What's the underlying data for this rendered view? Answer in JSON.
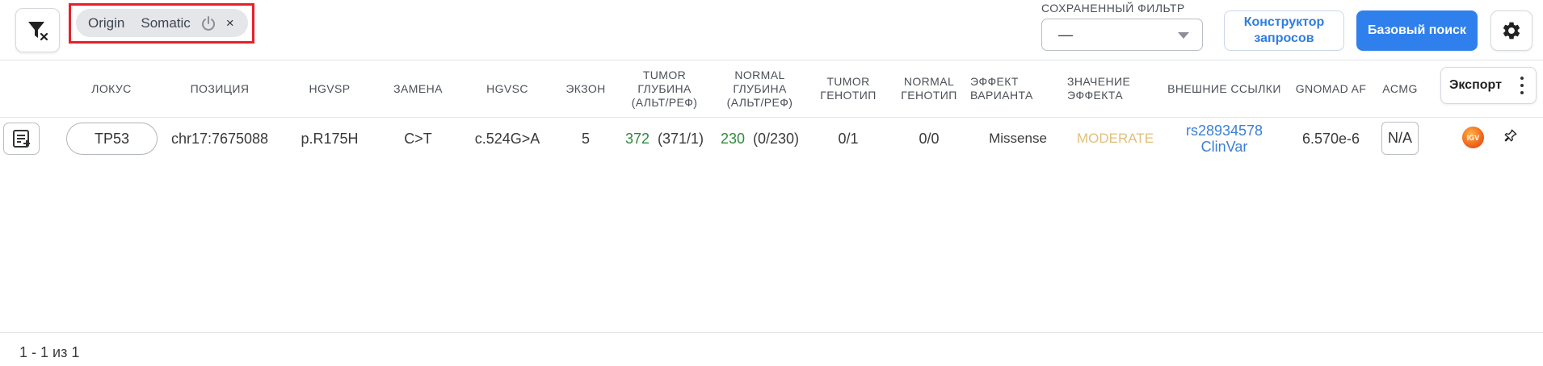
{
  "active_filter": {
    "label": "Origin",
    "value": "Somatic",
    "power_icon": "power-icon",
    "close_symbol": "×"
  },
  "saved_filter": {
    "label": "СОХРАНЕННЫЙ ФИЛЬТР",
    "value": "—"
  },
  "buttons": {
    "query_builder": [
      "Конструктор",
      "запросов"
    ],
    "basic_search": "Базовый поиск",
    "export": "Экспорт",
    "settings_icon": "gear-icon",
    "clear_filter_icon": "filter-clear-icon"
  },
  "colors": {
    "primary": "#2f80ed",
    "link": "#3a7fd6",
    "depth_green": "#2f8a3e",
    "moderate": "#e0c07a",
    "highlight": "#e8202a"
  },
  "table": {
    "columns": {
      "locus": "ЛОКУС",
      "position": "ПОЗИЦИЯ",
      "hgvsp": "HGVSP",
      "substitution": "ЗАМЕНА",
      "hgvsc": "HGVSC",
      "exon": "ЭКЗОН",
      "tumor_depth": [
        "TUMOR",
        "ГЛУБИНА",
        "(АЛЬТ/РЕФ)"
      ],
      "normal_depth": [
        "NORMAL",
        "ГЛУБИНА",
        "(АЛЬТ/РЕФ)"
      ],
      "tumor_genotype": [
        "TUMOR",
        "ГЕНОТИП"
      ],
      "normal_genotype": [
        "NORMAL",
        "ГЕНОТИП"
      ],
      "variant_effect": [
        "ЭФФЕКТ",
        "ВАРИАНТА"
      ],
      "effect_impact": [
        "ЗНАЧЕНИЕ",
        "ЭФФЕКТА"
      ],
      "external_links": "ВНЕШНИЕ ССЫЛКИ",
      "gnomad_af": "GNOMAD AF",
      "acmg": "ACMG"
    },
    "rows": [
      {
        "locus": "TP53",
        "position": "chr17:7675088",
        "hgvsp": "p.R175H",
        "substitution": "C>T",
        "hgvsc": "c.524G>A",
        "exon": "5",
        "tumor_depth_total": "372",
        "tumor_depth_ratio": "(371/1)",
        "normal_depth_total": "230",
        "normal_depth_ratio": "(0/230)",
        "tumor_genotype": "0/1",
        "normal_genotype": "0/0",
        "variant_effect": "Missense",
        "effect_impact": "MODERATE",
        "links": [
          "rs28934578",
          "ClinVar"
        ],
        "gnomad_af": "6.570e-6",
        "acmg": "N/A",
        "igv_label": "IGV"
      }
    ]
  },
  "pagination": "1 - 1 из 1"
}
